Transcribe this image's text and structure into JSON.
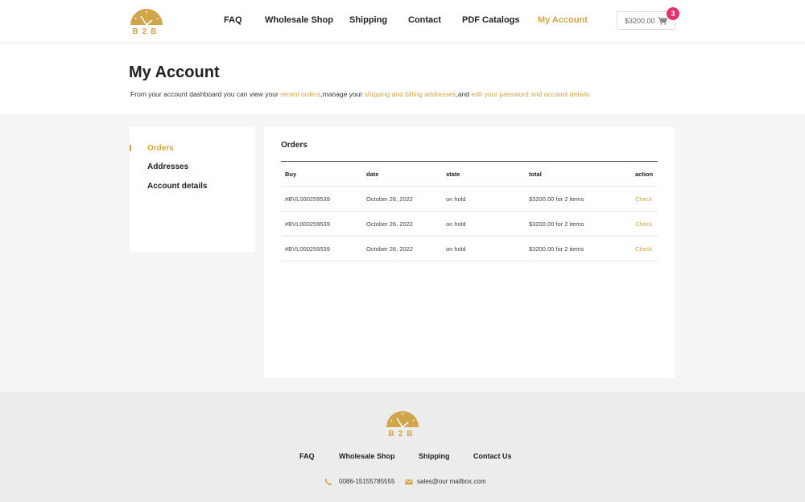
{
  "brand": {
    "logo_text": "B2B",
    "accent": "#d1a54a"
  },
  "nav": {
    "items": [
      {
        "label": "FAQ"
      },
      {
        "label": "Wholesale Shop"
      },
      {
        "label": "Shipping"
      },
      {
        "label": "Contact"
      },
      {
        "label": "PDF Catalogs"
      },
      {
        "label": "My Account"
      }
    ],
    "active": "My Account"
  },
  "cart": {
    "amount": "$3200.00",
    "count": "3",
    "icon": "cart-icon",
    "badge_color": "#e8306c"
  },
  "page": {
    "title": "My Account",
    "intro_prefix": "From your account dashboard you can view your ",
    "intro_link1": "recent orders",
    "intro_mid1": ",manage your ",
    "intro_link2": "shipping and billing addresses",
    "intro_mid2": ",and ",
    "intro_link3": "edit your password and account details"
  },
  "sidebar": {
    "items": [
      {
        "label": "Orders"
      },
      {
        "label": "Addresses"
      },
      {
        "label": "Account details"
      }
    ],
    "active": "Orders"
  },
  "orders": {
    "title": "Orders",
    "columns": [
      "Buy",
      "date",
      "state",
      "total",
      "action"
    ],
    "rows": [
      {
        "buy": "#BVL000259539",
        "date": "October 26, 2022",
        "state": "on hold",
        "total": "$3200.00 for 2 items",
        "action": "Check"
      },
      {
        "buy": "#BVL000259539",
        "date": "October 26, 2022",
        "state": "on hold",
        "total": "$3200.00 for 2 items",
        "action": "Check"
      },
      {
        "buy": "#BVL000259539",
        "date": "October 26, 2022",
        "state": "on hold",
        "total": "$3200.00 for 2 items",
        "action": "Check"
      }
    ]
  },
  "footer": {
    "links": [
      {
        "label": "FAQ"
      },
      {
        "label": "Wholesale Shop"
      },
      {
        "label": "Shipping"
      },
      {
        "label": "Contact Us"
      }
    ],
    "phone": "0086-15155785555",
    "email": "sales@our mailbox.com",
    "phone_icon": "phone-icon",
    "email_icon": "mail-icon"
  }
}
